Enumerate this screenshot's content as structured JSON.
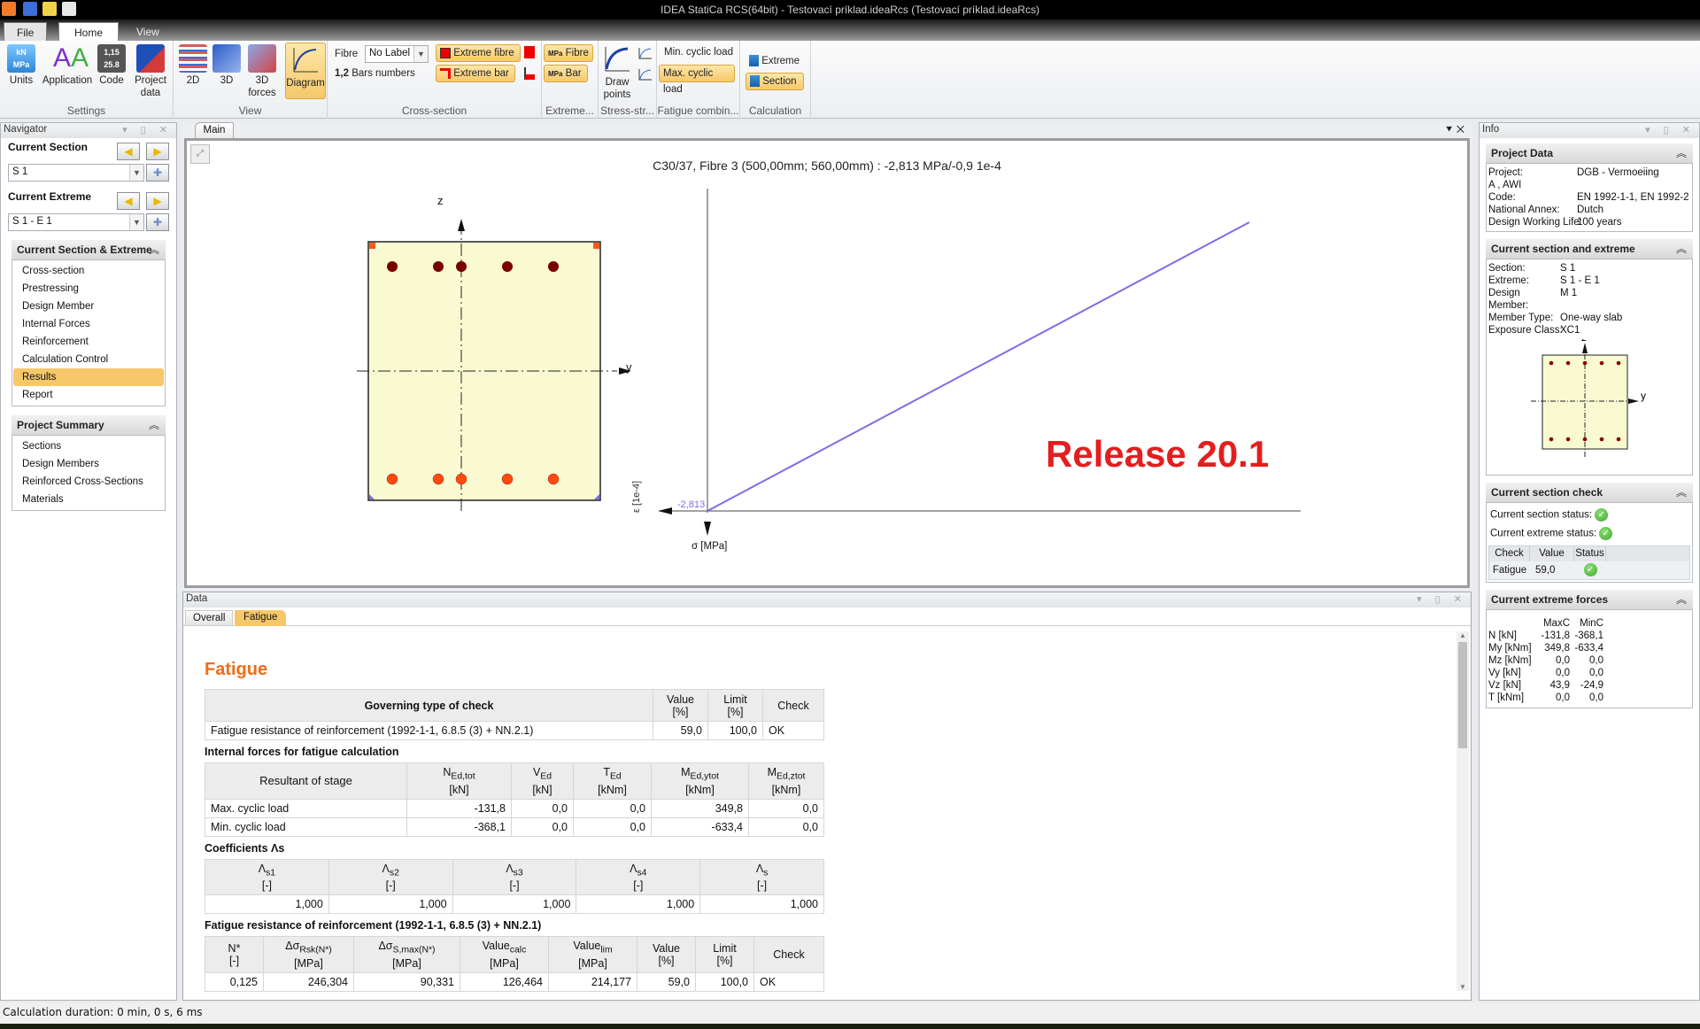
{
  "window": {
    "title": "IDEA StatiCa RCS(64bit) - Testovací príklad.ideaRcs (Testovací príklad.ideaRcs)"
  },
  "ribbon_tabs": [
    {
      "label": "File"
    },
    {
      "label": "Home"
    },
    {
      "label": "View"
    }
  ],
  "ribbon": {
    "settings": {
      "label": "Settings",
      "units": "Units",
      "application": "Application",
      "code": "Code",
      "project_data_1": "Project",
      "project_data_2": "data"
    },
    "view": {
      "label": "View",
      "b2d": "2D",
      "b3d": "3D",
      "forces_1": "3D",
      "forces_2": "forces",
      "diagram": "Diagram"
    },
    "cross_section": {
      "label": "Cross-section",
      "fibre_label": "Fibre",
      "fibre_value": "No Label",
      "extreme_fibre": "Extreme fibre",
      "extreme_bar": "Extreme bar",
      "bars_numbers_prefix": "1,2",
      "bars_numbers": "Bars numbers"
    },
    "extreme": {
      "label": "Extreme...",
      "fibre": "Fibre",
      "bar": "Bar",
      "mpa": "MPa"
    },
    "stress_strain": {
      "label": "Stress-str...",
      "draw_points_1": "Draw",
      "draw_points_2": "points"
    },
    "fatigue": {
      "label": "Fatigue combin...",
      "min": "Min. cyclic load",
      "max": "Max. cyclic load"
    },
    "calculation": {
      "label": "Calculation",
      "extreme": "Extreme",
      "section": "Section"
    }
  },
  "navigator": {
    "title": "Navigator",
    "current_section_label": "Current Section",
    "current_section_value": "S 1",
    "current_extreme_label": "Current Extreme",
    "current_extreme_value": "S 1 - E 1",
    "group1": {
      "title": "Current Section & Extreme",
      "items": [
        "Cross-section",
        "Prestressing",
        "Design Member",
        "Internal Forces",
        "Reinforcement",
        "Calculation Control",
        "Results",
        "Report"
      ],
      "selected": "Results"
    },
    "group2": {
      "title": "Project Summary",
      "items": [
        "Sections",
        "Design Members",
        "Reinforced Cross-Sections",
        "Materials"
      ]
    }
  },
  "main": {
    "tab": "Main",
    "diagram_title": "C30/37, Fibre 3 (500,00mm; 560,00mm) : -2,813 MPa/-0,9 1e-4",
    "axis_z": "z",
    "axis_y": "y",
    "strain_axis": "ε [1e-4]",
    "stress_axis": "σ [MPa]",
    "origin_label": "-2,813",
    "release": "Release 20.1",
    "line_color": "#7b6ee8"
  },
  "data_panel": {
    "title": "Data",
    "tabs": [
      "Overall",
      "Fatigue"
    ],
    "active_tab": "Fatigue",
    "heading": "Fatigue",
    "governing": {
      "headers": [
        "Governing type of check",
        "Value [%]",
        "Limit [%]",
        "Check"
      ],
      "row": [
        "Fatigue resistance of reinforcement (1992-1-1, 6.8.5 (3) + NN.2.1)",
        "59,0",
        "100,0",
        "OK"
      ]
    },
    "internal_forces": {
      "title": "Internal forces for fatigue calculation",
      "headers": [
        {
          "main": "Resultant of stage",
          "sub": "",
          "unit": ""
        },
        {
          "main": "N",
          "sub": "Ed,tot",
          "unit": "[kN]"
        },
        {
          "main": "V",
          "sub": "Ed",
          "unit": "[kN]"
        },
        {
          "main": "T",
          "sub": "Ed",
          "unit": "[kNm]"
        },
        {
          "main": "M",
          "sub": "Ed,ytot",
          "unit": "[kNm]"
        },
        {
          "main": "M",
          "sub": "Ed,ztot",
          "unit": "[kNm]"
        }
      ],
      "rows": [
        [
          "Max. cyclic load",
          "-131,8",
          "0,0",
          "0,0",
          "349,8",
          "0,0"
        ],
        [
          "Min. cyclic load",
          "-368,1",
          "0,0",
          "0,0",
          "-633,4",
          "0,0"
        ]
      ]
    },
    "coefficients": {
      "title": "Coefficients Λs",
      "headers": [
        {
          "main": "Λ",
          "sub": "s1",
          "unit": "[-]"
        },
        {
          "main": "Λ",
          "sub": "s2",
          "unit": "[-]"
        },
        {
          "main": "Λ",
          "sub": "s3",
          "unit": "[-]"
        },
        {
          "main": "Λ",
          "sub": "s4",
          "unit": "[-]"
        },
        {
          "main": "Λ",
          "sub": "s",
          "unit": "[-]"
        }
      ],
      "row": [
        "1,000",
        "1,000",
        "1,000",
        "1,000",
        "1,000"
      ]
    },
    "resistance": {
      "title": "Fatigue resistance of reinforcement (1992-1-1, 6.8.5 (3) + NN.2.1)",
      "headers": [
        {
          "main": "N*",
          "sub": "",
          "unit": "[-]"
        },
        {
          "main": "Δσ",
          "sub": "Rsk(N*)",
          "unit": "[MPa]"
        },
        {
          "main": "Δσ",
          "sub": "S,max(N*)",
          "unit": "[MPa]"
        },
        {
          "main": "Value",
          "sub": "calc",
          "unit": "[MPa]"
        },
        {
          "main": "Value",
          "sub": "lim",
          "unit": "[MPa]"
        },
        {
          "main": "Value",
          "sub": "",
          "unit": "[%]"
        },
        {
          "main": "Limit",
          "sub": "",
          "unit": "[%]"
        },
        {
          "main": "Check",
          "sub": "",
          "unit": ""
        }
      ],
      "row": [
        "0,125",
        "246,304",
        "90,331",
        "126,464",
        "214,177",
        "59,0",
        "100,0",
        "OK"
      ]
    }
  },
  "info": {
    "title": "Info",
    "project_data": {
      "title": "Project Data",
      "rows": [
        {
          "k": "Project:",
          "v": "DGB - Vermoeiing"
        },
        {
          "k": "A , AWI",
          "v": ""
        },
        {
          "k": "Code:",
          "v": "EN 1992-1-1, EN 1992-2"
        },
        {
          "k": "National Annex:",
          "v": "Dutch"
        },
        {
          "k": "Design Working Life:",
          "v": "100 years"
        }
      ]
    },
    "current_section": {
      "title": "Current section and extreme",
      "rows": [
        {
          "k": "Section:",
          "v": "S 1"
        },
        {
          "k": "Extreme:",
          "v": "S 1 - E 1"
        },
        {
          "k": "Design Member:",
          "v": "M 1"
        },
        {
          "k": "Member Type:",
          "v": "One-way slab"
        },
        {
          "k": "Exposure Class:",
          "v": "XC1"
        }
      ]
    },
    "section_check": {
      "title": "Current section check",
      "section_status": "Current section status:",
      "extreme_status": "Current extreme status:",
      "headers": [
        "Check",
        "Value",
        "Status"
      ],
      "row": {
        "check": "Fatigue",
        "value": "59,0",
        "status": "ok"
      }
    },
    "extreme_forces": {
      "title": "Current extreme forces",
      "headers": [
        "",
        "MaxC",
        "MinC"
      ],
      "rows": [
        [
          "N [kN]",
          "-131,8",
          "-368,1"
        ],
        [
          "My [kNm]",
          "349,8",
          "-633,4"
        ],
        [
          "Mz [kNm]",
          "0,0",
          "0,0"
        ],
        [
          "Vy [kN]",
          "0,0",
          "0,0"
        ],
        [
          "Vz [kN]",
          "43,9",
          "-24,9"
        ],
        [
          "T [kNm]",
          "0,0",
          "0,0"
        ]
      ]
    }
  },
  "status_bar": {
    "text": "Calculation duration: 0 min, 0 s, 6 ms"
  }
}
